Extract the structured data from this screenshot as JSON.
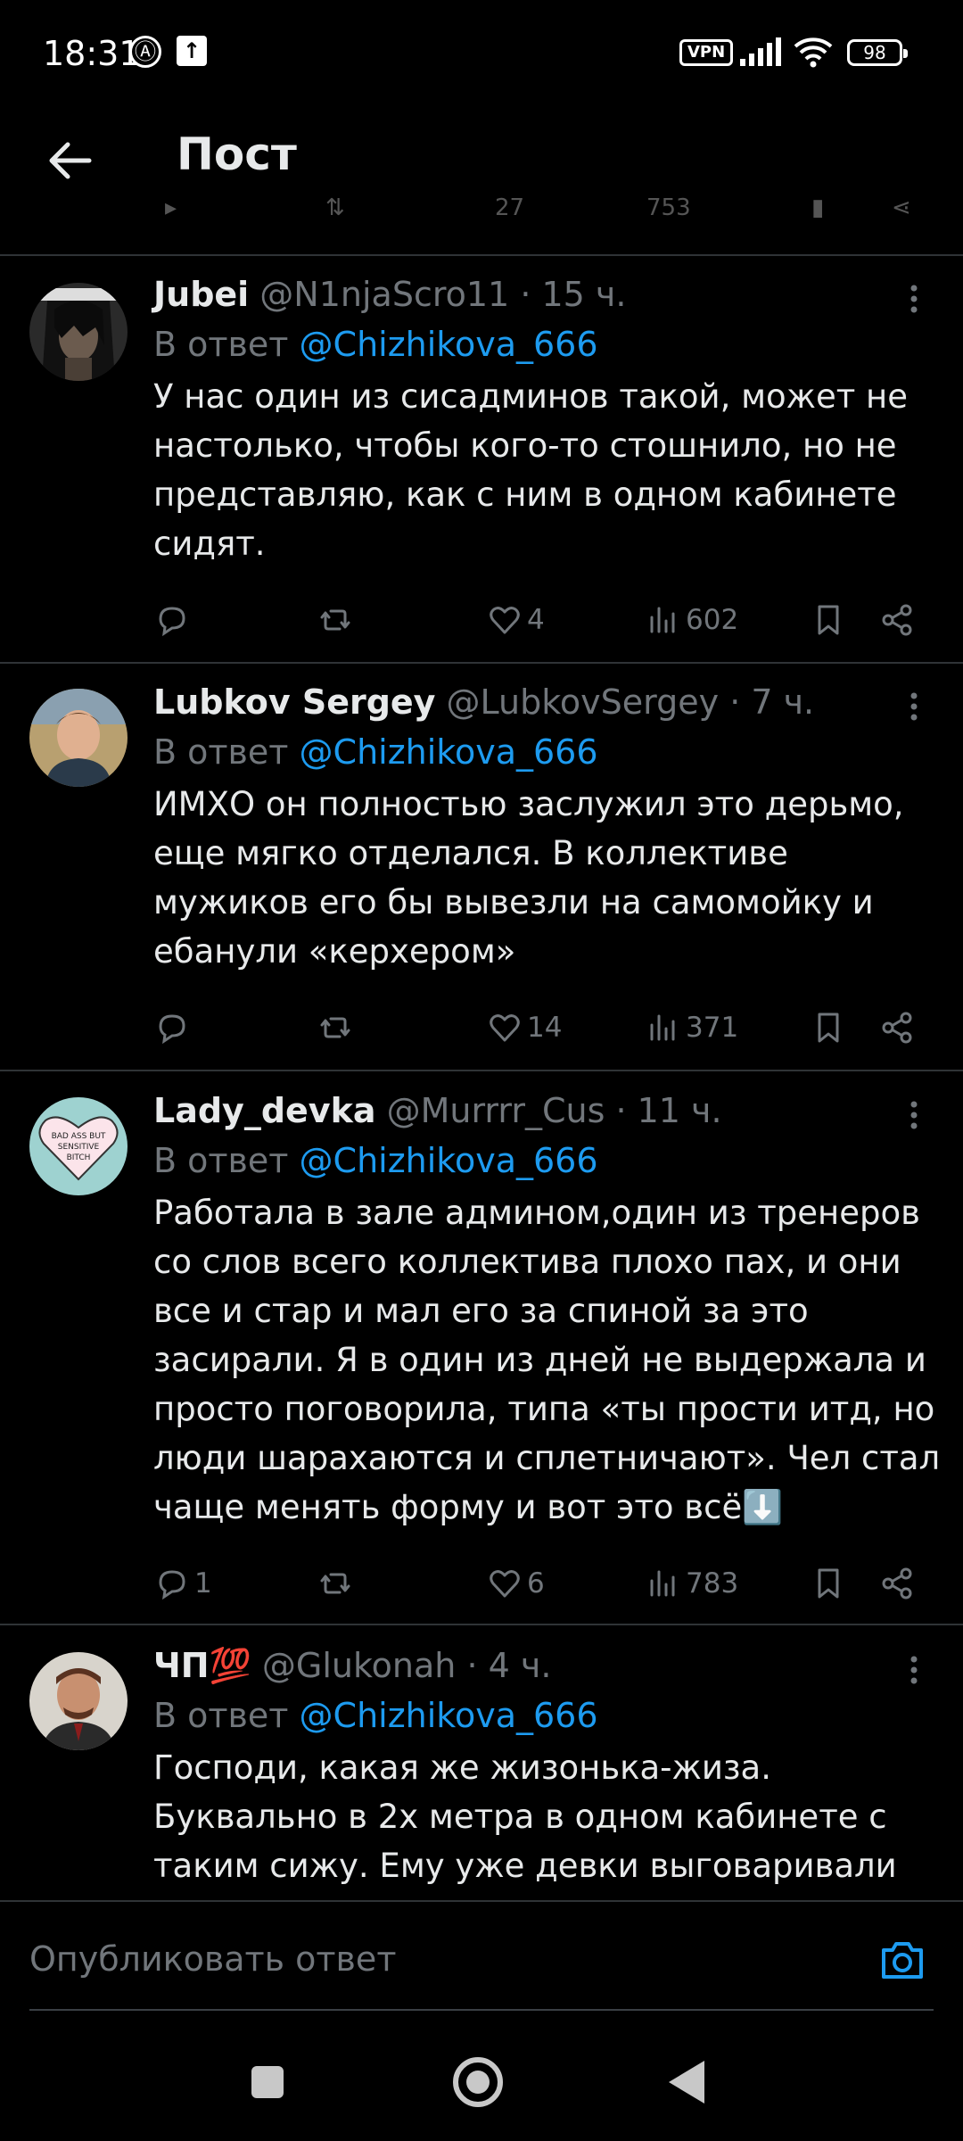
{
  "status_bar": {
    "time": "18:31",
    "vpn": "VPN",
    "battery": "98"
  },
  "header": {
    "title": "Пост"
  },
  "ghost_row": {
    "likes": "27",
    "views": "753"
  },
  "posts": [
    {
      "name": "Jubei",
      "handle": "@N1njaScro11",
      "time": "· 15 ч.",
      "reply_prefix": "В ответ",
      "reply_handle": "@Chizhikova_666",
      "text": "У нас один из сисадминов такой, может не настолько, чтобы кого-то стошнило, но не представляю, как с ним в одном кабинете сидят.",
      "replies": "",
      "likes": "4",
      "views": "602"
    },
    {
      "name": "Lubkov Sergey",
      "handle": "@LubkovSergey",
      "time": "· 7 ч.",
      "reply_prefix": "В ответ",
      "reply_handle": "@Chizhikova_666",
      "text": "ИМХО он полностью заслужил это дерьмо, еще мягко отделался. В коллективе мужиков его бы вывезли на самомойку и ебанули «керхером»",
      "replies": "",
      "likes": "14",
      "views": "371"
    },
    {
      "name": "Lady_devka",
      "handle": "@Murrrr_Cus",
      "time": "· 11 ч.",
      "reply_prefix": "В ответ",
      "reply_handle": "@Chizhikova_666",
      "text": "Работала в зале админом,один из тренеров со слов всего коллектива плохо пах, и они все и стар и мал его за спиной за это засирали. Я в один из дней не выдержала и просто поговорила, типа «ты прости итд, но люди шарахаются и сплетничают». Чел стал чаще менять форму и вот это всё⬇️",
      "replies": "1",
      "likes": "6",
      "views": "783"
    },
    {
      "name": "ЧП💯",
      "handle": "@Glukonah",
      "time": "· 4 ч.",
      "reply_prefix": "В ответ",
      "reply_handle": "@Chizhikova_666",
      "text": "Господи, какая же жизонька-жиза. Буквально в 2х метра в одном кабинете с таким сижу. Ему уже девки выговаривали",
      "replies": "",
      "likes": "",
      "views": ""
    }
  ],
  "avatar_texts": {
    "lady_devka": "BAD ASS BUT SENSITIVE BITCH"
  },
  "composer": {
    "placeholder": "Опубликовать ответ"
  },
  "colors": {
    "background": "#000000",
    "text": "#e7e9ea",
    "muted": "#71767b",
    "link": "#1d9bf0",
    "separator": "#2f3336"
  }
}
